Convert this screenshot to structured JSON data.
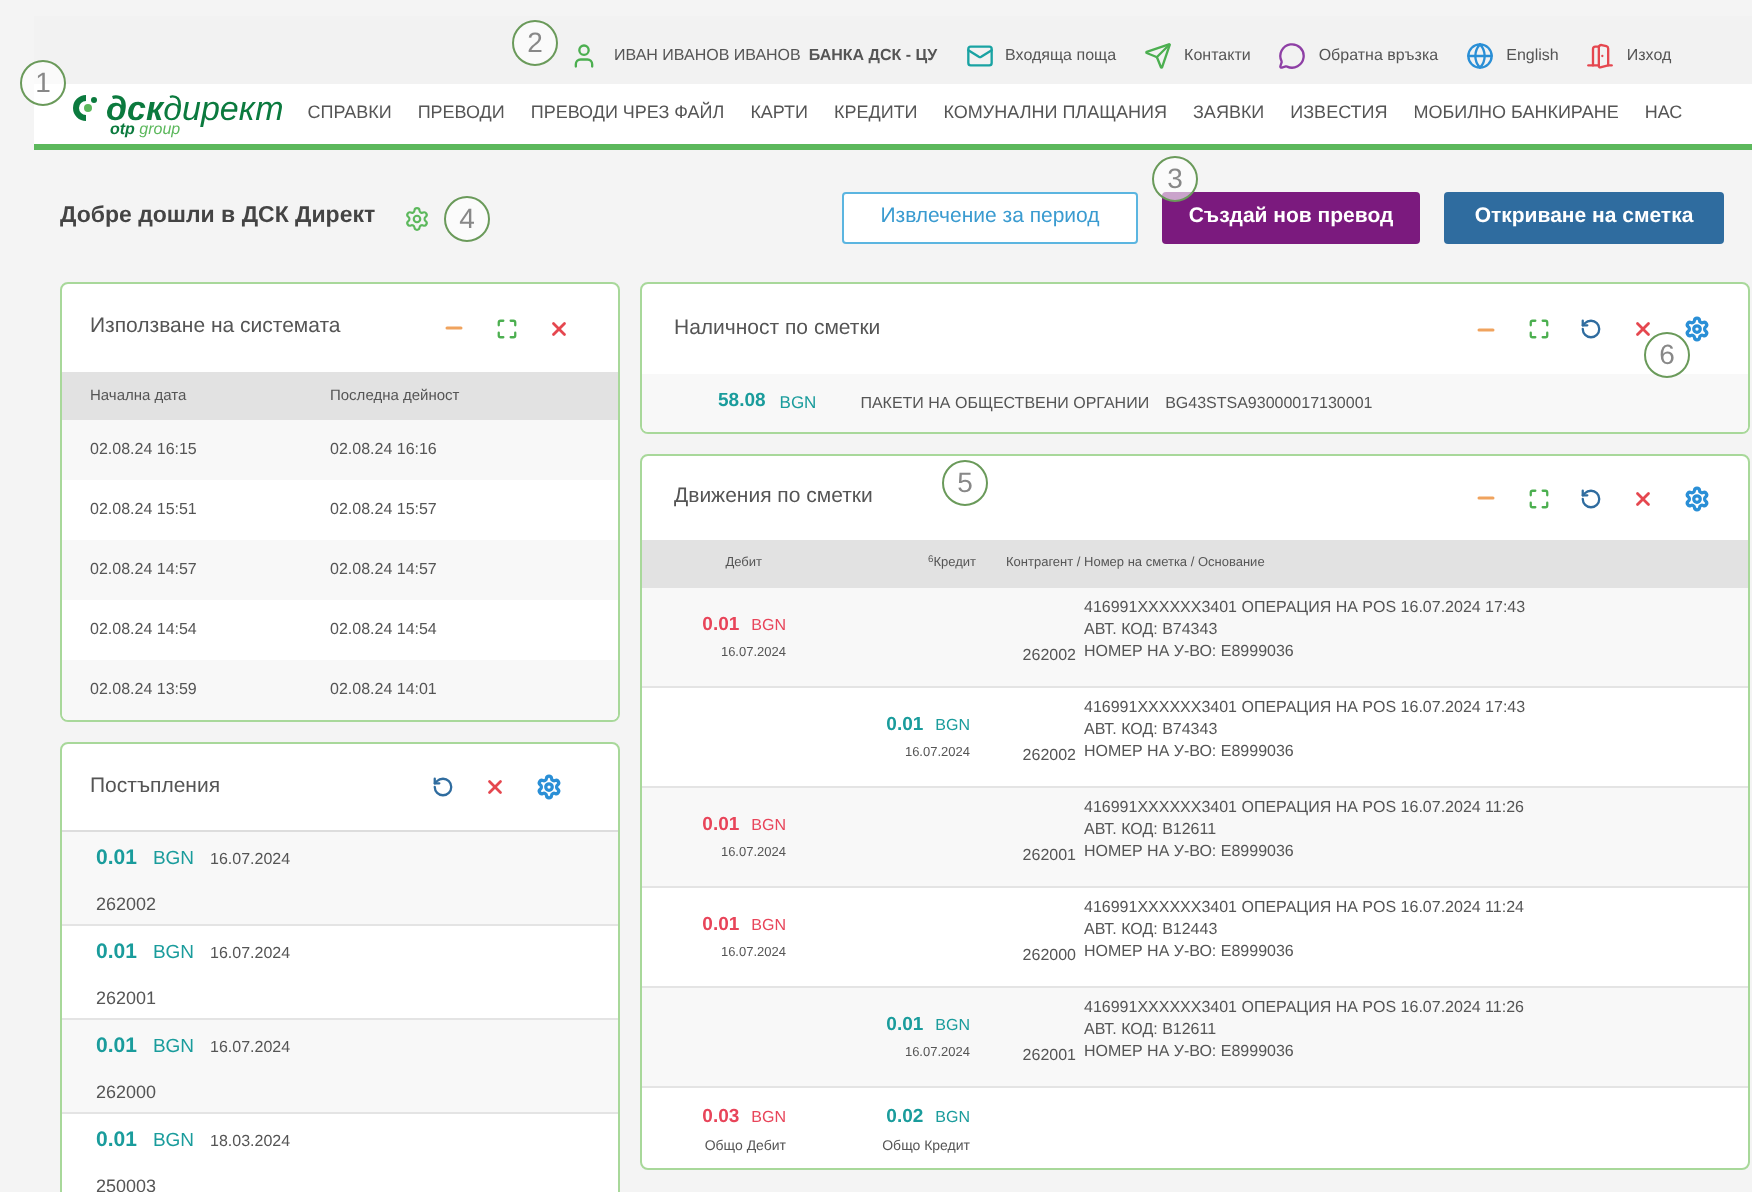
{
  "top_bar": {
    "user": "ИВАН ИВАНОВ ИВАНОВ",
    "branch": "БАНКА ДСК - ЦУ",
    "links": [
      {
        "kind": "mail",
        "label": "Входяща поща"
      },
      {
        "kind": "send",
        "label": "Контакти"
      },
      {
        "kind": "chat",
        "label": "Обратна връзка"
      },
      {
        "kind": "globe",
        "label": "English"
      },
      {
        "kind": "exit",
        "label": "Изход"
      }
    ]
  },
  "logo": {
    "name": "дск",
    "name2": "директ",
    "sub1": "otp",
    "sub2": "group"
  },
  "nav": [
    "СПРАВКИ",
    "ПРЕВОДИ",
    "ПРЕВОДИ ЧРЕЗ ФАЙЛ",
    "КАРТИ",
    "КРЕДИТИ",
    "КОМУНАЛНИ ПЛАЩАНИЯ",
    "ЗАЯВКИ",
    "ИЗВЕСТИЯ",
    "МОБИЛНО БАНКИРАНЕ",
    "НАС"
  ],
  "welcome": "Добре дошли в ДСК Директ",
  "actions": [
    {
      "kind": "outline",
      "label": "Извлечение за период"
    },
    {
      "kind": "purple",
      "label": "Създай нов превод"
    },
    {
      "kind": "blue",
      "label": "Откриване на сметка"
    }
  ],
  "usage": {
    "title": "Използване на системата",
    "columns": [
      "Начална дата",
      "Последна дейност"
    ],
    "rows": [
      [
        "02.08.24 16:15",
        "02.08.24 16:16"
      ],
      [
        "02.08.24 15:51",
        "02.08.24 15:57"
      ],
      [
        "02.08.24 14:57",
        "02.08.24 14:57"
      ],
      [
        "02.08.24 14:54",
        "02.08.24 14:54"
      ],
      [
        "02.08.24 13:59",
        "02.08.24 14:01"
      ]
    ]
  },
  "incoming": {
    "title": "Постъпления",
    "items": [
      {
        "amount": "0.01",
        "currency": "BGN",
        "date": "16.07.2024",
        "ref": "262002"
      },
      {
        "amount": "0.01",
        "currency": "BGN",
        "date": "16.07.2024",
        "ref": "262001"
      },
      {
        "amount": "0.01",
        "currency": "BGN",
        "date": "16.07.2024",
        "ref": "262000"
      },
      {
        "amount": "0.01",
        "currency": "BGN",
        "date": "18.03.2024",
        "ref": "250003"
      }
    ]
  },
  "balance": {
    "title": "Наличност по сметки",
    "amount": "58.08",
    "currency": "BGN",
    "account_name": "ПАКЕТИ НА ОБЩЕСТВЕНИ ОРГАНИИ",
    "iban": "BG43STSA93000017130001"
  },
  "movements": {
    "title": "Движения по сметки",
    "columns": [
      "Дебит",
      "$^{6}$Кредит",
      "Контрагент / Номер на сметка / Основание"
    ],
    "rows": [
      {
        "kind": "debit",
        "amount": "0.01",
        "currency": "BGN",
        "date": "16.07.2024",
        "account": "262002",
        "lines": [
          "416991XXXXXX3401 ОПЕРАЦИЯ НА POS 16.07.2024 17:43",
          "АВТ. КОД: B74343",
          "НОМЕР НА У-ВО: E8999036"
        ]
      },
      {
        "kind": "credit",
        "amount": "0.01",
        "currency": "BGN",
        "date": "16.07.2024",
        "account": "262002",
        "lines": [
          "416991XXXXXX3401 ОПЕРАЦИЯ НА POS 16.07.2024 17:43",
          "АВТ. КОД: B74343",
          "НОМЕР НА У-ВО: E8999036"
        ]
      },
      {
        "kind": "debit",
        "amount": "0.01",
        "currency": "BGN",
        "date": "16.07.2024",
        "account": "262001",
        "lines": [
          "416991XXXXXX3401 ОПЕРАЦИЯ НА POS 16.07.2024 11:26",
          "АВТ. КОД: B12611",
          "НОМЕР НА У-ВО: E8999036"
        ]
      },
      {
        "kind": "debit",
        "amount": "0.01",
        "currency": "BGN",
        "date": "16.07.2024",
        "account": "262000",
        "lines": [
          "416991XXXXXX3401 ОПЕРАЦИЯ НА POS 16.07.2024 11:24",
          "АВТ. КОД: B12443",
          "НОМЕР НА У-ВО: E8999036"
        ]
      },
      {
        "kind": "credit",
        "amount": "0.01",
        "currency": "BGN",
        "date": "16.07.2024",
        "account": "262001",
        "lines": [
          "416991XXXXXX3401 ОПЕРАЦИЯ НА POS 16.07.2024 11:26",
          "АВТ. КОД: B12611",
          "НОМЕР НА У-ВО: E8999036"
        ]
      }
    ],
    "totals": {
      "debit_amount": "0.03",
      "debit_currency": "BGN",
      "debit_label": "Общо Дебит",
      "credit_amount": "0.02",
      "credit_currency": "BGN",
      "credit_label": "Общо Кредит"
    }
  },
  "callouts": [
    "1",
    "2",
    "3",
    "4",
    "5",
    "6"
  ]
}
